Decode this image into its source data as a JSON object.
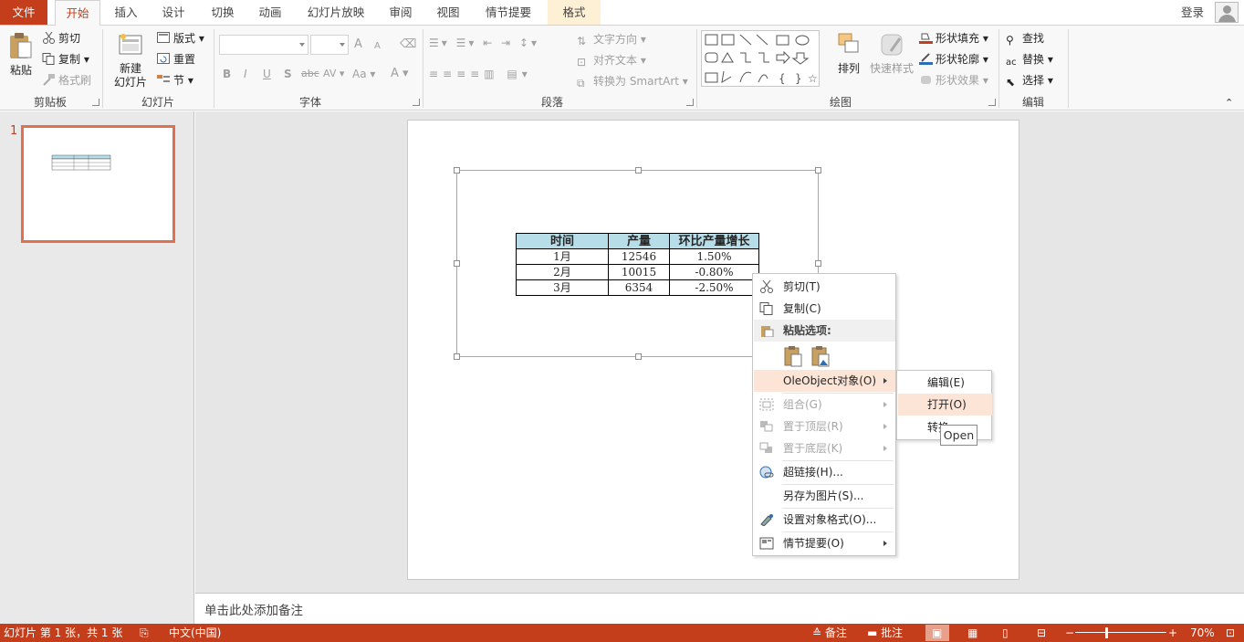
{
  "colors": {
    "accent": "#c43e1c",
    "selection": "#e0704f",
    "table_header": "#b7dde8",
    "menu_highlight": "#fce4d6"
  },
  "tabs": [
    {
      "label": "文件",
      "kind": "file"
    },
    {
      "label": "开始",
      "kind": "active"
    },
    {
      "label": "插入"
    },
    {
      "label": "设计"
    },
    {
      "label": "切换"
    },
    {
      "label": "动画"
    },
    {
      "label": "幻灯片放映"
    },
    {
      "label": "审阅"
    },
    {
      "label": "视图"
    },
    {
      "label": "情节提要"
    },
    {
      "label": "格式",
      "kind": "contextual"
    }
  ],
  "account": {
    "login": "登录"
  },
  "ribbon": {
    "clipboard": {
      "label": "剪贴板",
      "paste": "粘贴",
      "cut": "剪切",
      "copy": "复制",
      "format_painter": "格式刷"
    },
    "slides": {
      "label": "幻灯片",
      "new_slide_1": "新建",
      "new_slide_2": "幻灯片",
      "layout": "版式",
      "reset": "重置",
      "section": "节"
    },
    "font": {
      "label": "字体",
      "font_name": "",
      "font_size": "",
      "bold": "B",
      "italic": "I",
      "underline": "U",
      "shadow": "S",
      "strike": "abc",
      "spacing": "AV",
      "case": "Aa",
      "color": "A",
      "grow": "A",
      "shrink": "A"
    },
    "paragraph": {
      "label": "段落",
      "text_direction": "文字方向",
      "align_text": "对齐文本",
      "smartart": "转换为 SmartArt"
    },
    "drawing": {
      "label": "绘图",
      "arrange": "排列",
      "quick_styles": "快速样式",
      "fill": "形状填充",
      "outline": "形状轮廓",
      "effects": "形状效果"
    },
    "editing": {
      "label": "编辑",
      "find": "查找",
      "replace": "替换",
      "select": "选择"
    }
  },
  "slide_panel": {
    "slide_number": "1"
  },
  "table": {
    "headers": [
      "时间",
      "产量",
      "环比产量增长"
    ],
    "rows": [
      [
        "1月",
        "12546",
        "1.50%"
      ],
      [
        "2月",
        "10015",
        "-0.80%"
      ],
      [
        "3月",
        "6354",
        "-2.50%"
      ]
    ]
  },
  "context_menu": {
    "cut": "剪切(T)",
    "copy": "复制(C)",
    "paste_options": "粘贴选项:",
    "ole_object": "OleObject对象(O)",
    "group": "组合(G)",
    "bring_front": "置于顶层(R)",
    "send_back": "置于底层(K)",
    "hyperlink": "超链接(H)...",
    "save_as_picture": "另存为图片(S)...",
    "format_object": "设置对象格式(O)...",
    "storyboard": "情节提要(O)"
  },
  "submenu": {
    "edit": "编辑(E)",
    "open": "打开(O)",
    "convert": "转换"
  },
  "tooltip": "Open",
  "notes": {
    "placeholder": "单击此处添加备注"
  },
  "status": {
    "slide_info": "幻灯片 第 1 张，共 1 张",
    "language": "中文(中国)",
    "notes": "备注",
    "comments": "批注",
    "zoom": "70%",
    "zoom_level": 0.7
  }
}
